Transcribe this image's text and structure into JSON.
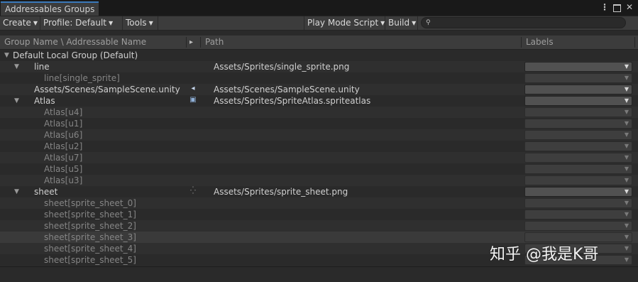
{
  "window": {
    "tab_title": "Addressables Groups",
    "controls": {
      "menu_icon": "kebab-menu-icon",
      "maximize_icon": "maximize-icon",
      "close_icon": "close-icon"
    }
  },
  "toolbar": {
    "create": "Create",
    "profile": "Profile: Default",
    "tools": "Tools",
    "play_mode_script": "Play Mode Script",
    "build": "Build",
    "search_placeholder": ""
  },
  "columns": {
    "name": "Group Name \\ Addressable Name",
    "path": "Path",
    "labels": "Labels"
  },
  "tree": {
    "group_name": "Default Local Group (Default)",
    "entries": [
      {
        "name": "line",
        "path": "Assets/Sprites/single_sprite.png",
        "icon": "",
        "type": "parent",
        "label": ""
      },
      {
        "name": "line[single_sprite]",
        "path": "",
        "icon": "",
        "type": "child",
        "label": ""
      },
      {
        "name": "Assets/Scenes/SampleScene.unity",
        "path": "Assets/Scenes/SampleScene.unity",
        "icon": "scene-icon",
        "type": "leaf",
        "label": ""
      },
      {
        "name": "Atlas",
        "path": "Assets/Sprites/SpriteAtlas.spriteatlas",
        "icon": "sprite-atlas-icon",
        "type": "parent",
        "label": ""
      },
      {
        "name": "Atlas[u4]",
        "path": "",
        "icon": "",
        "type": "child",
        "label": ""
      },
      {
        "name": "Atlas[u1]",
        "path": "",
        "icon": "",
        "type": "child",
        "label": ""
      },
      {
        "name": "Atlas[u6]",
        "path": "",
        "icon": "",
        "type": "child",
        "label": ""
      },
      {
        "name": "Atlas[u2]",
        "path": "",
        "icon": "",
        "type": "child",
        "label": ""
      },
      {
        "name": "Atlas[u7]",
        "path": "",
        "icon": "",
        "type": "child",
        "label": ""
      },
      {
        "name": "Atlas[u5]",
        "path": "",
        "icon": "",
        "type": "child",
        "label": ""
      },
      {
        "name": "Atlas[u3]",
        "path": "",
        "icon": "",
        "type": "child",
        "label": ""
      },
      {
        "name": "sheet",
        "path": "Assets/Sprites/sprite_sheet.png",
        "icon": "loading-icon",
        "type": "parent",
        "label": ""
      },
      {
        "name": "sheet[sprite_sheet_0]",
        "path": "",
        "icon": "",
        "type": "child",
        "label": ""
      },
      {
        "name": "sheet[sprite_sheet_1]",
        "path": "",
        "icon": "",
        "type": "child",
        "label": ""
      },
      {
        "name": "sheet[sprite_sheet_2]",
        "path": "",
        "icon": "",
        "type": "child",
        "label": ""
      },
      {
        "name": "sheet[sprite_sheet_3]",
        "path": "",
        "icon": "",
        "type": "child",
        "label": "",
        "selected": true
      },
      {
        "name": "sheet[sprite_sheet_4]",
        "path": "",
        "icon": "",
        "type": "child",
        "label": ""
      },
      {
        "name": "sheet[sprite_sheet_5]",
        "path": "",
        "icon": "",
        "type": "child",
        "label": ""
      }
    ]
  },
  "watermark": "知乎 @我是K哥",
  "colors": {
    "background": "#2a2a2a",
    "toolbar": "#3c3c3c",
    "tab_accent": "#3a79bb",
    "label_dropdown": "#515151"
  }
}
